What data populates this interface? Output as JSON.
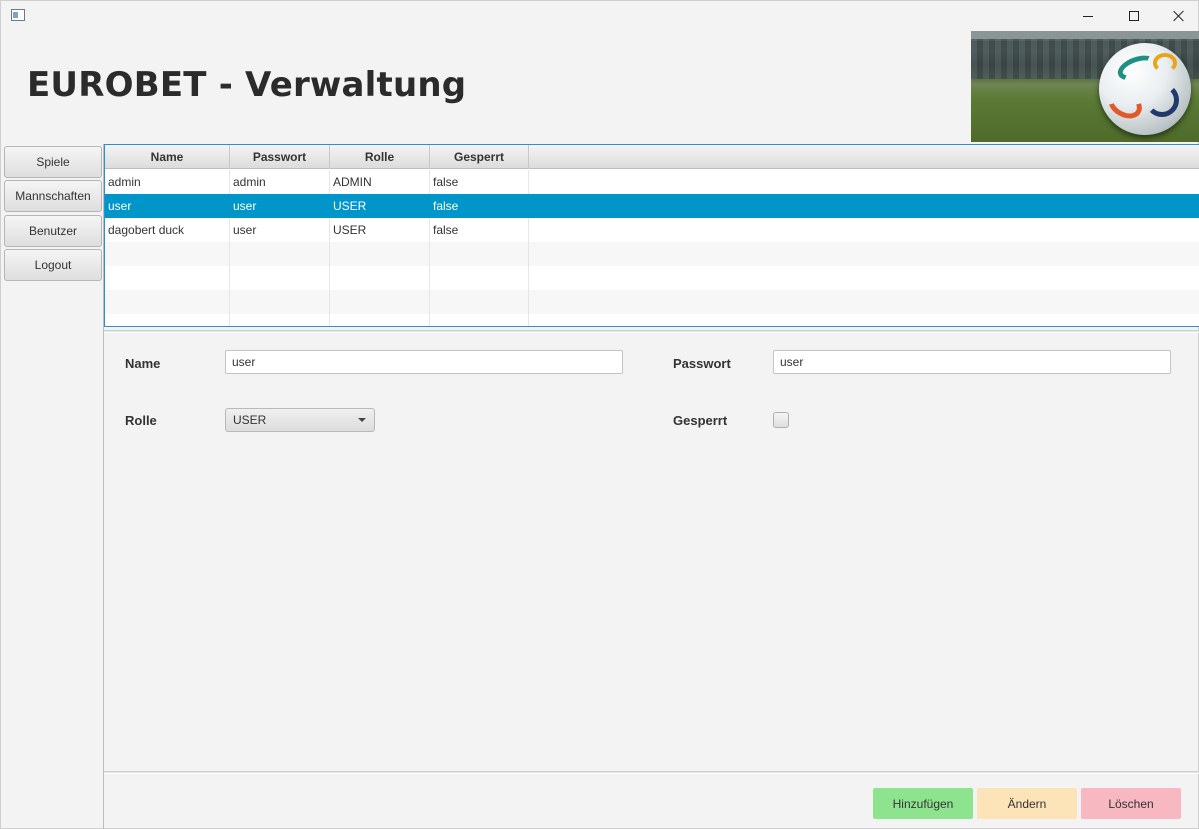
{
  "header": {
    "title": "EUROBET - Verwaltung"
  },
  "sidebar": {
    "items": [
      {
        "label": "Spiele"
      },
      {
        "label": "Mannschaften"
      },
      {
        "label": "Benutzer"
      },
      {
        "label": "Logout"
      }
    ]
  },
  "table": {
    "columns": [
      "Name",
      "Passwort",
      "Rolle",
      "Gesperrt"
    ],
    "rows": [
      [
        "admin",
        "admin",
        "ADMIN",
        "false"
      ],
      [
        "user",
        "user",
        "USER",
        "false"
      ],
      [
        "dagobert duck",
        "user",
        "USER",
        "false"
      ]
    ],
    "selected_row_index": 1
  },
  "form": {
    "name_label": "Name",
    "name_value": "user",
    "password_label": "Passwort",
    "password_value": "user",
    "role_label": "Rolle",
    "role_value": "USER",
    "locked_label": "Gesperrt",
    "locked_checked": false
  },
  "actions": {
    "add": "Hinzufügen",
    "edit": "Ändern",
    "delete": "Löschen"
  },
  "colors": {
    "selection": "#0096c9",
    "add": "#8ee48e",
    "edit": "#fde4b8",
    "delete": "#f7b8c2",
    "table_border": "#2e8fd0"
  },
  "icons": {
    "app": "app-window-icon",
    "minimize": "minimize-icon",
    "maximize": "maximize-icon",
    "close": "close-icon",
    "banner": "football-stadium-image"
  }
}
